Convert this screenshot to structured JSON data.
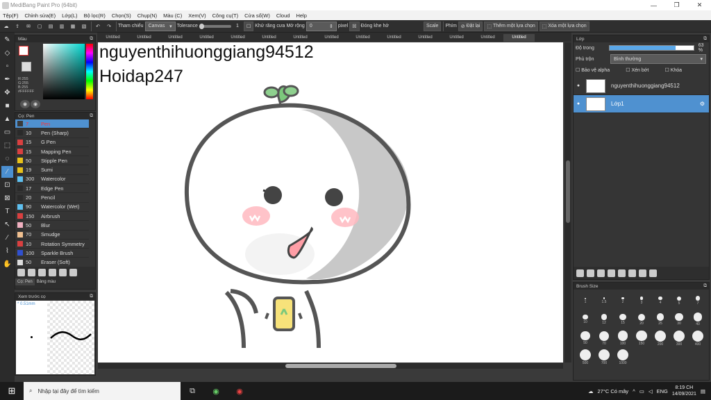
{
  "window": {
    "title": "MediBang Paint Pro (64bit)",
    "min": "—",
    "max": "❐",
    "close": "✕"
  },
  "menu": [
    "Tệp(F)",
    "Chỉnh sửa(E)",
    "Lớp(L)",
    "Bộ lọc(R)",
    "Chọn(S)",
    "Chụp(N)",
    "Màu (C)",
    "Xem(V)",
    "Công cụ(T)",
    "Cửa sổ(W)",
    "Cloud",
    "Help"
  ],
  "toolbar": {
    "ref_label": "Tham chiếu",
    "ref_value": "Canvas",
    "tol_label": "Tolerance",
    "tol_value": "1",
    "antialias": "Khử răng cưa",
    "expand": "Mở rộng",
    "expand_value": "0",
    "expand_unit": "pixel",
    "close_gap": "Đóng khe hở",
    "scale": "Scale",
    "key": "Phím",
    "reset": "Đặt lại",
    "add_sel": "Thêm một lựa chọn",
    "del_sel": "Xóa một lựa chọn"
  },
  "color_panel": {
    "title": "Màu",
    "r": "R:255",
    "g": "G:255",
    "b": "B:255",
    "hex": "#FFFFFF",
    "fg": "#ffffff",
    "bg": "#e6e6e6"
  },
  "brush_panel": {
    "title": "Cọ: Pen",
    "tab_brush": "Cọ: Pen",
    "tab_palette": "Bảng màu"
  },
  "brushes": [
    {
      "size": "7",
      "name": "Pen",
      "color": "#3a3a3a"
    },
    {
      "size": "10",
      "name": "Pen (Sharp)",
      "color": "#2a2a2a"
    },
    {
      "size": "15",
      "name": "G Pen",
      "color": "#d94040"
    },
    {
      "size": "15",
      "name": "Mapping Pen",
      "color": "#d94040"
    },
    {
      "size": "50",
      "name": "Stipple Pen",
      "color": "#e8c21a"
    },
    {
      "size": "19",
      "name": "Sumi",
      "color": "#e8c21a"
    },
    {
      "size": "300",
      "name": "Watercolor",
      "color": "#5ec0f0"
    },
    {
      "size": "17",
      "name": "Edge Pen",
      "color": "#2a2a2a"
    },
    {
      "size": "20",
      "name": "Pencil",
      "color": "#2a2a2a"
    },
    {
      "size": "90",
      "name": "Watercolor (Wet)",
      "color": "#5ec0f0"
    },
    {
      "size": "150",
      "name": "Airbrush",
      "color": "#d94040"
    },
    {
      "size": "50",
      "name": "Blur",
      "color": "#f0b0c0"
    },
    {
      "size": "70",
      "name": "Smudge",
      "color": "#f0c090"
    },
    {
      "size": "10",
      "name": "Rotation Symmetry",
      "color": "#d94040"
    },
    {
      "size": "100",
      "name": "Sparkle Brush",
      "color": "#3050d0"
    },
    {
      "size": "50",
      "name": "Eraser (Soft)",
      "color": "#dddddd"
    }
  ],
  "preview_panel": {
    "title": "Xem trước cọ",
    "size": "* 0.51mm"
  },
  "tabs": [
    "Untitled",
    "Untitled",
    "Untitled",
    "Untitled",
    "Untitled",
    "Untitled",
    "Untitled",
    "Untitled",
    "Untitled",
    "Untitled",
    "Untitled",
    "Untitled",
    "Untitled",
    "Untitled"
  ],
  "canvas": {
    "line1": "nguyenthihuonggiang94512",
    "line2": "Hoidap247"
  },
  "layer_panel": {
    "title": "Lớp",
    "opacity_label": "Độ trong",
    "opacity_value": "63 %",
    "opacity": 0.79,
    "blend_label": "Phủ trộn",
    "blend_value": "Bình thường",
    "alpha": "Bảo vệ alpha",
    "clip": "Xén bớt",
    "lock": "Khóa"
  },
  "layers": [
    {
      "name": "nguyenthihuonggiang94512",
      "active": false
    },
    {
      "name": "Lớp1",
      "active": true
    }
  ],
  "brush_size_panel": {
    "title": "Brush Size"
  },
  "brush_sizes": [
    "1",
    "1.5",
    "2",
    "3",
    "4",
    "5",
    "7",
    "10",
    "12",
    "15",
    "20",
    "25",
    "30",
    "40",
    "50",
    "70",
    "100",
    "150",
    "200",
    "300",
    "400",
    "500",
    "700",
    "1000"
  ],
  "taskbar": {
    "search": "Nhập tại đây để tìm kiếm",
    "weather": "27°C Có mây",
    "lang": "ENG",
    "time": "8:19 CH",
    "date": "14/09/2021"
  }
}
